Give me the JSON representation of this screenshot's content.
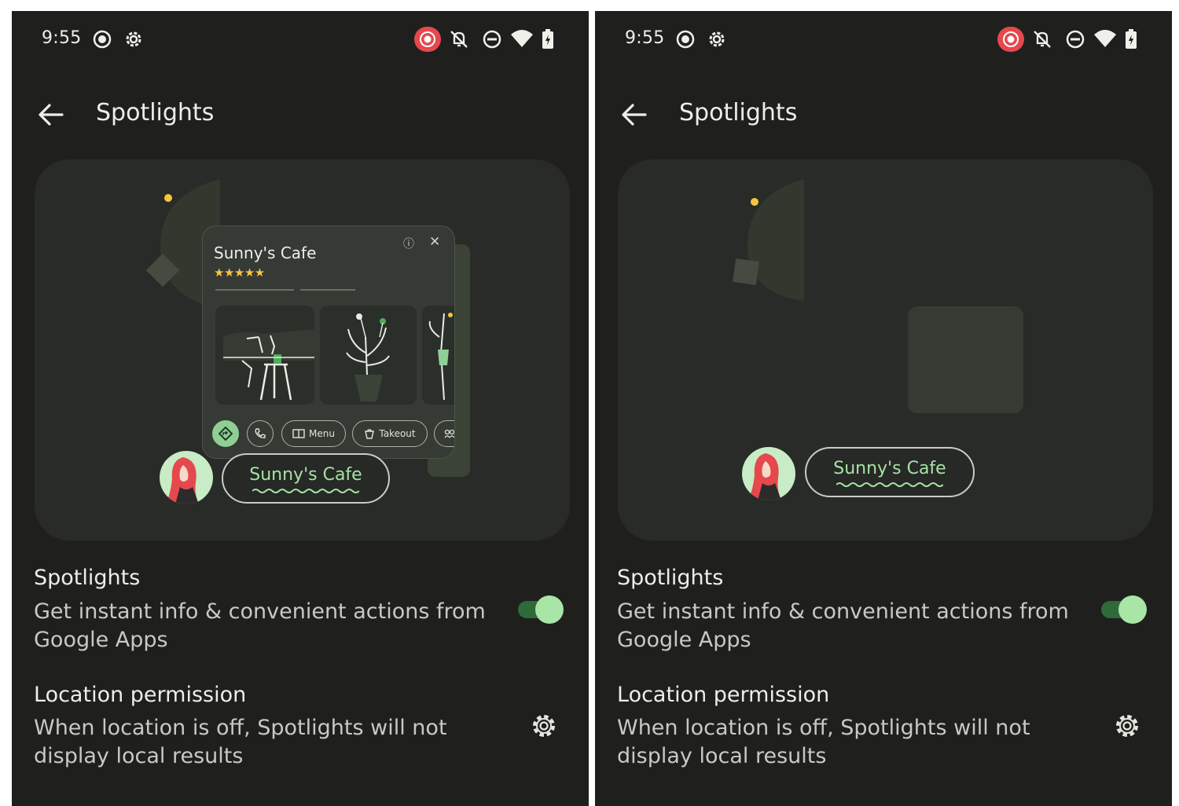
{
  "status_bar": {
    "time": "9:55",
    "icons": [
      "screen-record-icon",
      "settings-gear-icon",
      "recording-icon",
      "bell-off-icon",
      "do-not-disturb-icon",
      "wifi-icon",
      "battery-charging-icon"
    ]
  },
  "app_bar": {
    "title": "Spotlights",
    "back_icon": "arrow-back-icon"
  },
  "illustration": {
    "card_title": "Sunny's Cafe",
    "stars": "★★★★★",
    "rating": 4.5,
    "chips": {
      "menu": "Menu",
      "takeout": "Takeout"
    },
    "pill_label": "Sunny's Cafe"
  },
  "settings": {
    "spotlights": {
      "title": "Spotlights",
      "description": "Get instant info & convenient actions from Google Apps",
      "enabled": true
    },
    "location": {
      "title": "Location permission",
      "description": "When location is off, Spotlights will not display local results"
    }
  },
  "colors": {
    "background": "#1f201e",
    "card": "#282b27",
    "accent_green": "#a8e5a6",
    "toggle_track": "#2f6a3a",
    "rating_star": "#f5c542",
    "record_red": "#e5484d"
  }
}
